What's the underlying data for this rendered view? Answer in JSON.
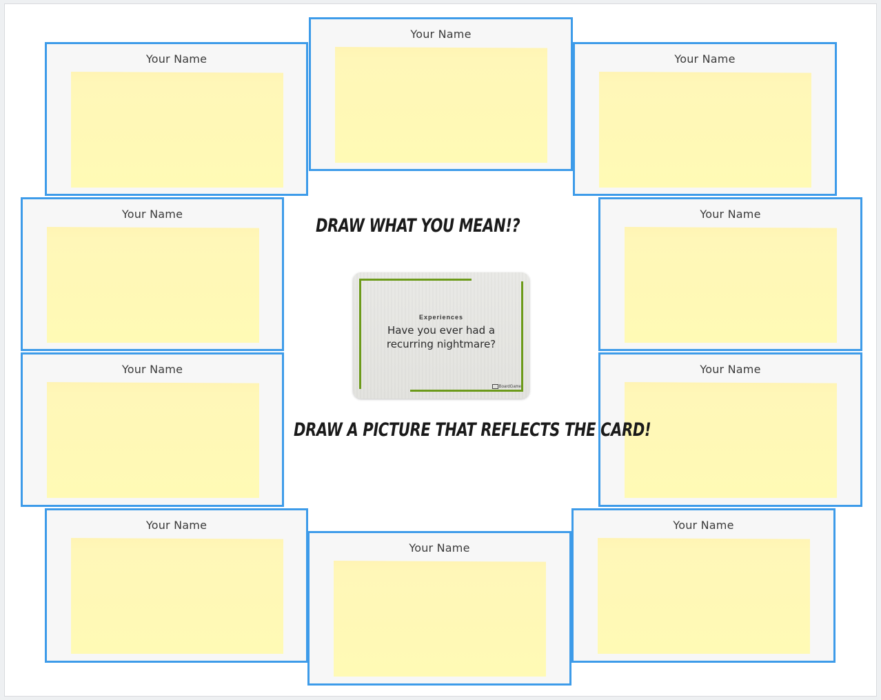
{
  "board": {
    "frames": [
      {
        "label": "Your Name"
      },
      {
        "label": "Your Name"
      },
      {
        "label": "Your Name"
      },
      {
        "label": "Your Name"
      },
      {
        "label": "Your Name"
      },
      {
        "label": "Your Name"
      },
      {
        "label": "Your Name"
      },
      {
        "label": "Your Name"
      },
      {
        "label": "Your Name"
      },
      {
        "label": "Your Name"
      }
    ],
    "heading_top": "DRAW WHAT YOU MEAN!?",
    "heading_bottom": "DRAW A PICTURE THAT REFLECTS THE CARD!",
    "card": {
      "category": "Experiences",
      "question": "Have you ever had a recurring nightmare?",
      "brand": "BoardGame"
    },
    "colors": {
      "frame_border": "#3d9be9",
      "sticky_note": "#fff9b5",
      "card_accent": "#6c9a1a"
    }
  }
}
